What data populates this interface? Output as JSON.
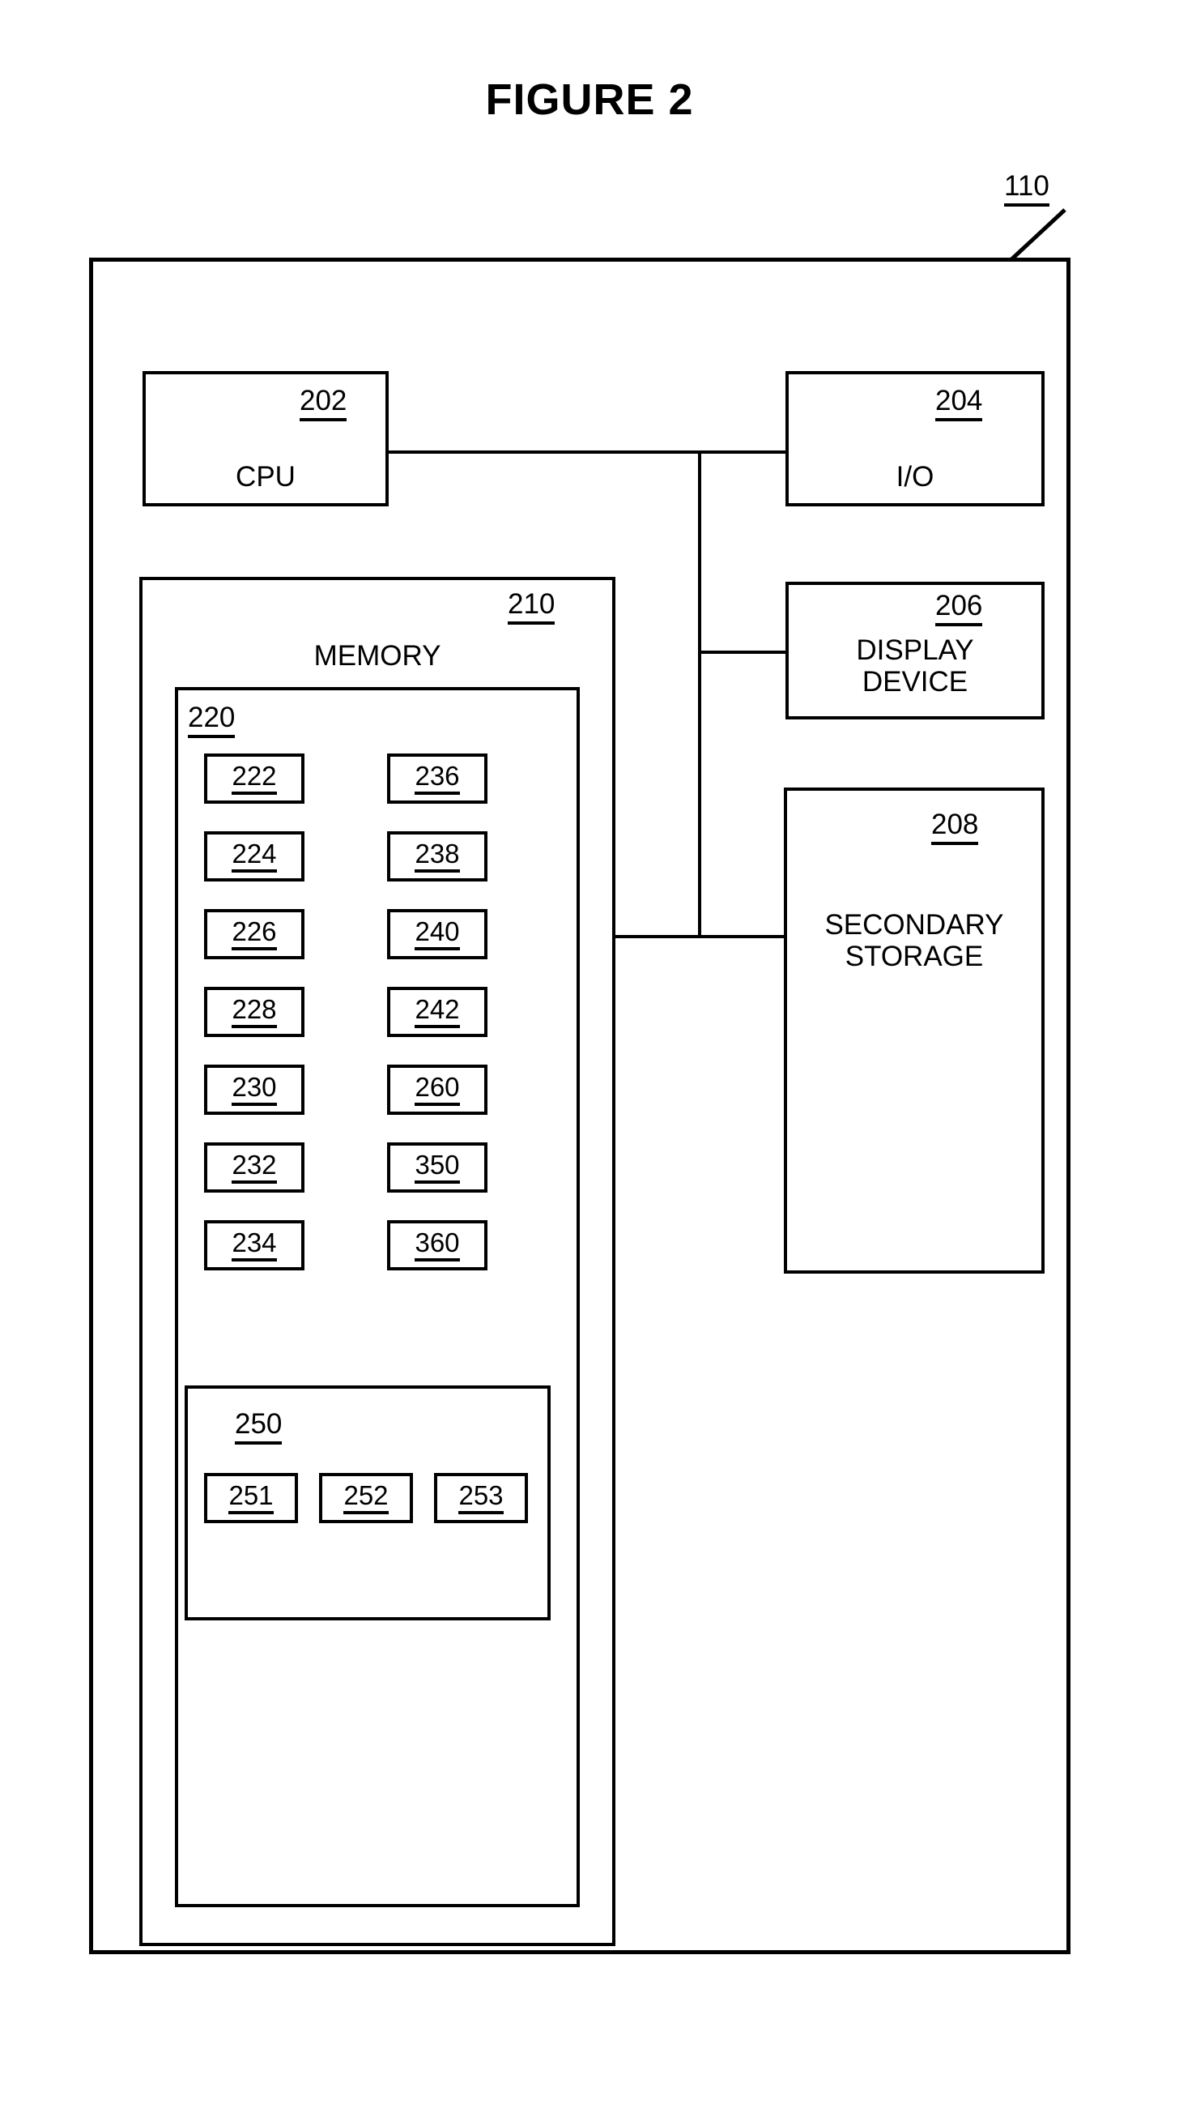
{
  "figure": {
    "title": "FIGURE 2",
    "system_ref": "110"
  },
  "blocks": {
    "cpu": {
      "ref": "202",
      "label": "CPU"
    },
    "io": {
      "ref": "204",
      "label": "I/O"
    },
    "display": {
      "ref": "206",
      "label": "DISPLAY\nDEVICE"
    },
    "secondary": {
      "ref": "208",
      "label": "SECONDARY\nSTORAGE"
    },
    "memory": {
      "ref": "210",
      "label": "MEMORY"
    },
    "program": {
      "ref": "220",
      "label": ""
    },
    "group250": {
      "ref": "250",
      "label": ""
    }
  },
  "module_columns": {
    "left": [
      "222",
      "224",
      "226",
      "228",
      "230",
      "232",
      "234"
    ],
    "right": [
      "236",
      "238",
      "240",
      "242",
      "260",
      "350",
      "360"
    ]
  },
  "group_250_items": [
    "251",
    "252",
    "253"
  ],
  "colors": {
    "ink": "#000000",
    "paper": "#ffffff"
  }
}
